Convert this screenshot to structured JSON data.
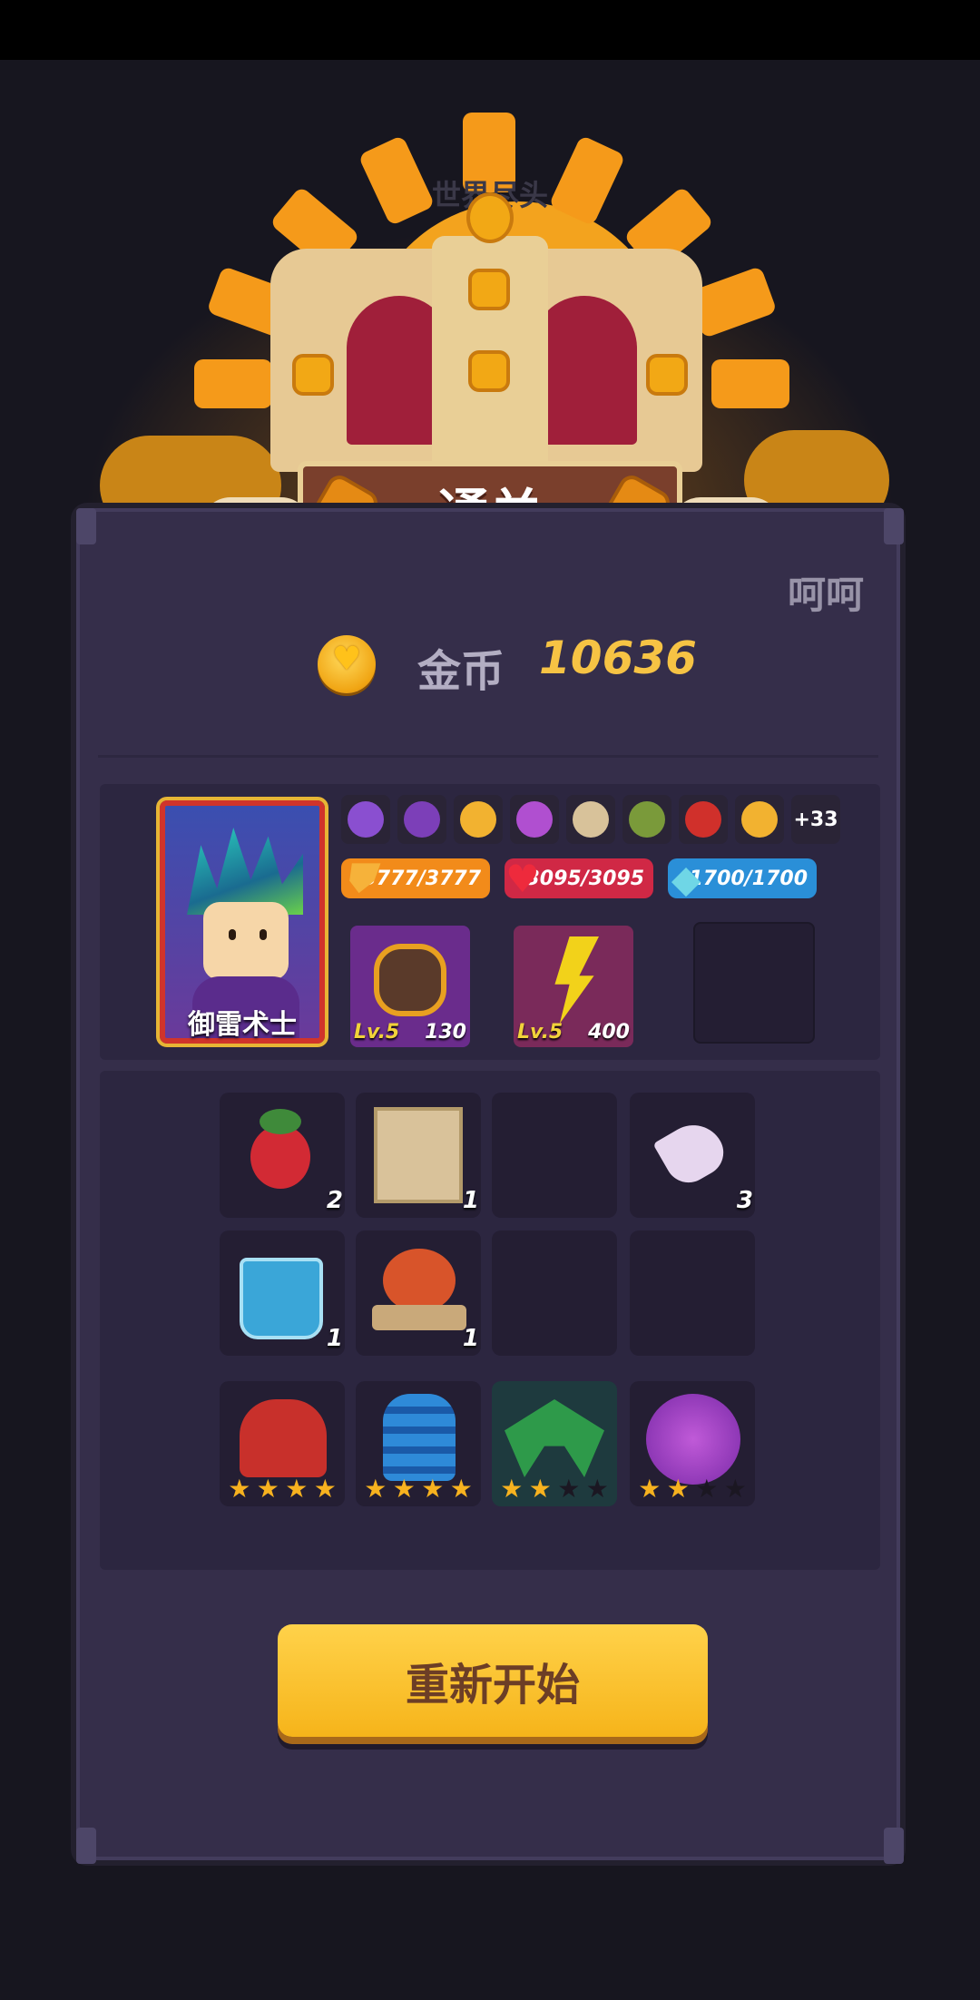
{
  "header": {
    "faded_text": "世界尽头"
  },
  "result": {
    "title": "通关"
  },
  "player": {
    "name": "呵呵"
  },
  "reward": {
    "coin_label": "金币",
    "coin_value": "10636",
    "coin_icon": "coin-icon"
  },
  "hero": {
    "name": "御雷术士",
    "badges": [
      {
        "icon": "medal-icon",
        "color": "#8a4fd0"
      },
      {
        "icon": "hood-mask-icon",
        "color": "#7c3fb8"
      },
      {
        "icon": "potion-icon",
        "color": "#f2b230"
      },
      {
        "icon": "spellbook-icon",
        "color": "#b04fd0"
      },
      {
        "icon": "scroll-map-icon",
        "color": "#d8c29a"
      },
      {
        "icon": "branch-icon",
        "color": "#7a9a3a"
      },
      {
        "icon": "helmet-icon",
        "color": "#d0302b"
      },
      {
        "icon": "thumbs-up-icon",
        "color": "#f2b230"
      }
    ],
    "more_badges": "+33",
    "stats": {
      "armor": {
        "text": "3777/3777",
        "icon": "shield-icon",
        "color": "#f28b1a"
      },
      "hp": {
        "text": "3095/3095",
        "icon": "heart-icon",
        "color": "#d02845"
      },
      "mana": {
        "text": "1700/1700",
        "icon": "crystal-icon",
        "color": "#2a8fd8"
      }
    },
    "skills": [
      {
        "level": "Lv.5",
        "value": "130",
        "icon": "thunder-fist-icon"
      },
      {
        "level": "Lv.5",
        "value": "400",
        "icon": "lightning-strike-icon"
      }
    ]
  },
  "inventory": {
    "items": [
      {
        "icon": "radish-icon",
        "count": "2"
      },
      {
        "icon": "wanted-poster-icon",
        "count": "1"
      },
      {
        "icon": "empty-slot",
        "count": ""
      },
      {
        "icon": "knife-icon",
        "count": "3"
      },
      {
        "icon": "drink-cup-icon",
        "count": "1"
      },
      {
        "icon": "roast-chicken-icon",
        "count": "1"
      },
      {
        "icon": "empty-slot",
        "count": ""
      },
      {
        "icon": "empty-slot",
        "count": ""
      }
    ],
    "equipment": [
      {
        "icon": "red-helmet-icon",
        "stars": 4,
        "max_stars": 4
      },
      {
        "icon": "blue-tower-icon",
        "stars": 4,
        "max_stars": 4
      },
      {
        "icon": "crossbow-icon",
        "stars": 2,
        "max_stars": 4
      },
      {
        "icon": "angel-girl-icon",
        "stars": 2,
        "max_stars": 4
      }
    ]
  },
  "actions": {
    "restart_label": "重新开始"
  }
}
